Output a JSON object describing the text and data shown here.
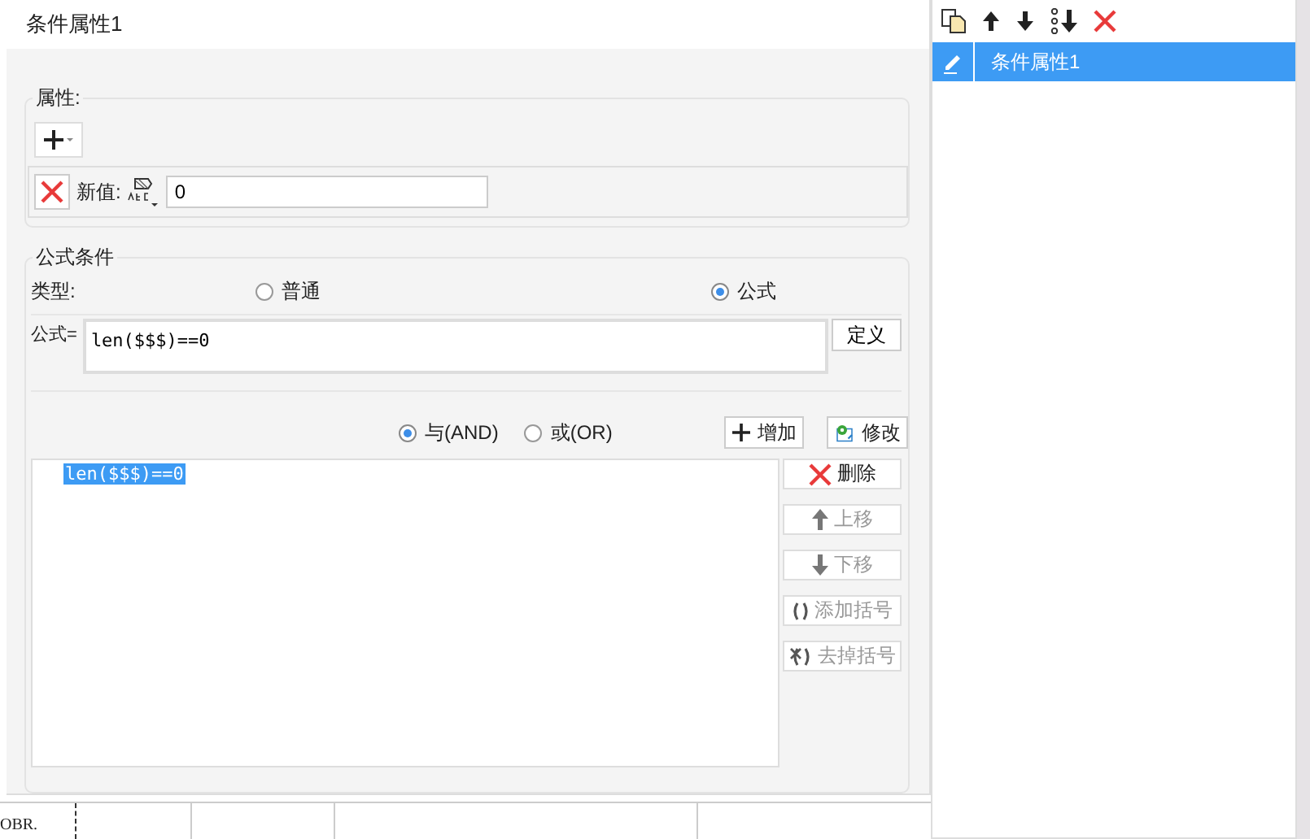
{
  "dialog": {
    "title": "条件属性1"
  },
  "properties": {
    "label": "属性:",
    "rows": [
      {
        "label": "新值:",
        "value": "0"
      }
    ]
  },
  "formula_condition": {
    "label": "公式条件",
    "type_label": "类型:",
    "types": [
      {
        "label": "普通",
        "selected": false
      },
      {
        "label": "公式",
        "selected": true
      }
    ],
    "formula_label": "公式=",
    "formula": "len($$$)==0",
    "define_button": "定义",
    "logic": [
      {
        "label": "与(AND)",
        "selected": true
      },
      {
        "label": "或(OR)",
        "selected": false
      }
    ],
    "add_button": "增加",
    "modify_button": "修改",
    "conditions": [
      {
        "text": "len($$$)==0",
        "selected": true
      }
    ],
    "actions": [
      {
        "kind": "delete",
        "label": "删除",
        "disabled": false
      },
      {
        "kind": "up",
        "label": "上移",
        "disabled": true
      },
      {
        "kind": "down",
        "label": "下移",
        "disabled": true
      },
      {
        "kind": "add-paren",
        "label": "添加括号",
        "disabled": true
      },
      {
        "kind": "remove-paren",
        "label": "去掉括号",
        "disabled": true
      }
    ]
  },
  "side_panel": {
    "items": [
      {
        "label": "条件属性1",
        "selected": true
      }
    ]
  },
  "background_sheet": {
    "cells": [
      "OBR."
    ]
  }
}
